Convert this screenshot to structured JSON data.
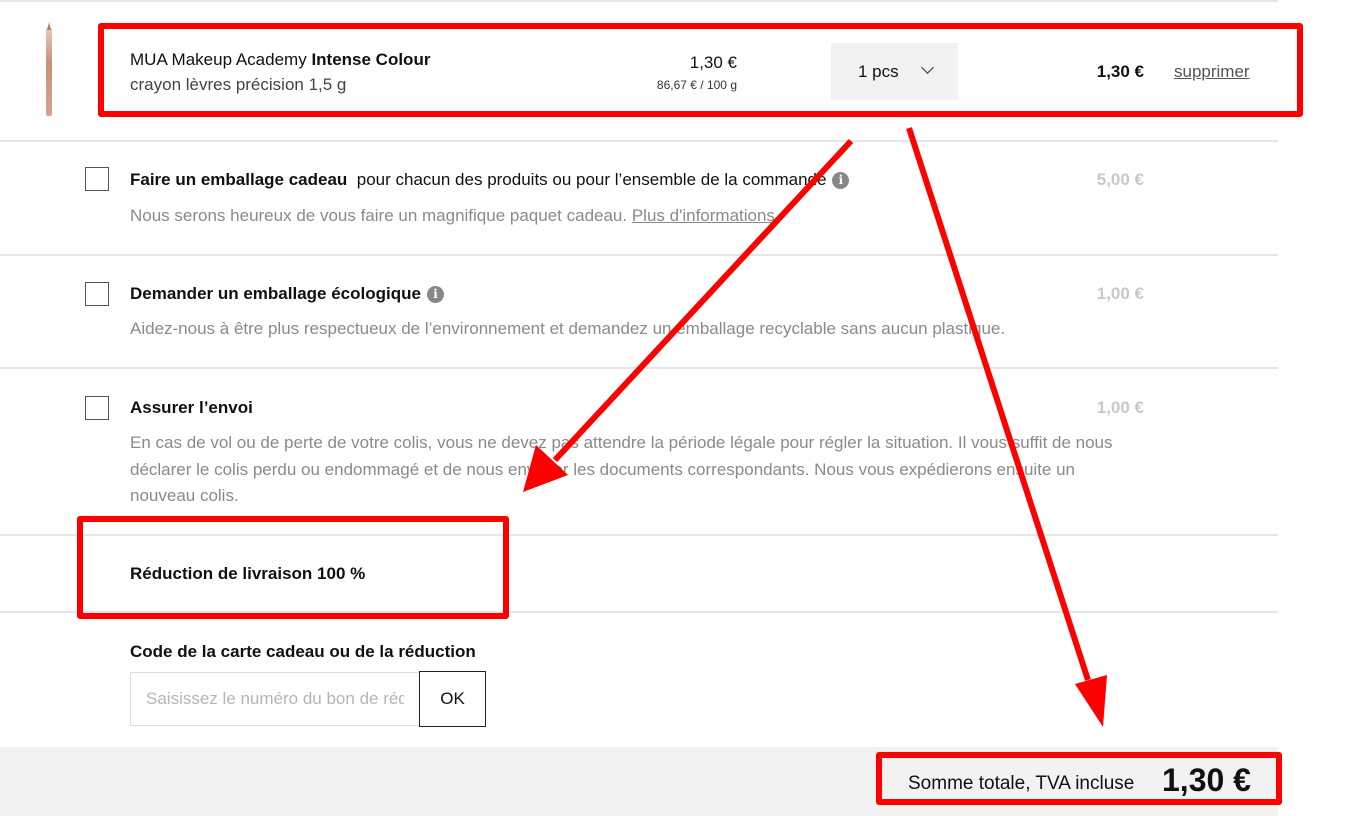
{
  "product": {
    "brand": "MUA Makeup Academy",
    "name": "Intense Colour",
    "subtitle": "crayon lèvres précision 1,5 g",
    "price": "1,30 €",
    "unit_price": "86,67 € / 100 g",
    "quantity": "1 pcs",
    "total": "1,30 €",
    "remove_label": "supprimer"
  },
  "options": [
    {
      "title": "Faire un emballage cadeau",
      "title_rest": "pour chacun des produits ou pour l’ensemble de la commande",
      "description": "Nous serons heureux de vous faire un magnifique paquet cadeau.",
      "link": "Plus d'informations",
      "price": "5,00 €"
    },
    {
      "title": "Demander un emballage écologique",
      "description": "Aidez-nous à être plus respectueux de l’environnement et demandez un emballage recyclable sans aucun plastique.",
      "price": "1,00 €"
    },
    {
      "title": "Assurer l’envoi",
      "description": "En cas de vol ou de perte de votre colis, vous ne devez pas attendre la période légale pour régler la situation. Il vous suffit de nous déclarer le colis perdu ou endommagé et de nous envoyer les documents correspondants. Nous vous expédierons ensuite un nouveau colis.",
      "price": "1,00 €"
    }
  ],
  "discount": {
    "label": "Réduction de livraison 100 %"
  },
  "voucher": {
    "label": "Code de la carte cadeau ou de la réduction",
    "placeholder": "Saisissez le numéro du bon de réduction",
    "button": "OK"
  },
  "summary": {
    "label": "Somme totale, TVA incluse",
    "value": "1,30 €"
  },
  "annotation_color": "#ff0000",
  "icons": {
    "info": "info-icon",
    "quantity_dropdown": "chevron-down-icon"
  }
}
